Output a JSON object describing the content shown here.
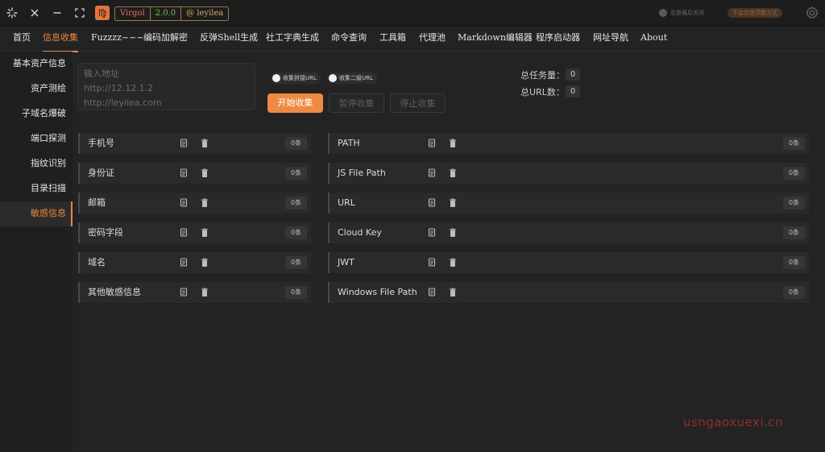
{
  "titlebar": {
    "badges": {
      "name": "Virgol",
      "version": "2.0.0",
      "user": "@ leyilea"
    },
    "toggle_label": "总是最后关闭",
    "pill_label": "不会总是顶置方式"
  },
  "menu": [
    {
      "label": "首页"
    },
    {
      "label": "信息收集"
    },
    {
      "label": "Fuzzzz~~~"
    },
    {
      "label": "编码加解密"
    },
    {
      "label": "反弹Shell生成"
    },
    {
      "label": "社工字典生成"
    },
    {
      "label": "命令查询"
    },
    {
      "label": "工具箱"
    },
    {
      "label": "代理池"
    },
    {
      "label": "Markdown编辑器"
    },
    {
      "label": "程序启动器"
    },
    {
      "label": "网址导航"
    },
    {
      "label": "About"
    }
  ],
  "sidebar": [
    {
      "label": "基本资产信息"
    },
    {
      "label": "资产测绘"
    },
    {
      "label": "子域名爆破"
    },
    {
      "label": "端口探测"
    },
    {
      "label": "指纹识别"
    },
    {
      "label": "目录扫描"
    },
    {
      "label": "敏感信息"
    }
  ],
  "url_input": {
    "placeholder": "输入地址\nhttp://12.12.1.2\nhttp://leyilea.com"
  },
  "options": {
    "collect_url": "收集拼接URL",
    "collect_second": "收集二级URL"
  },
  "buttons": {
    "start": "开始收集",
    "pause": "暂停收集",
    "stop": "停止收集"
  },
  "stats": {
    "total_tasks_label": "总任务量：",
    "total_tasks": "0",
    "total_urls_label": "总URL数：",
    "total_urls": "0"
  },
  "results_left": [
    {
      "label": "手机号",
      "count": "0条"
    },
    {
      "label": "身份证",
      "count": "0条"
    },
    {
      "label": "邮箱",
      "count": "0条"
    },
    {
      "label": "密码字段",
      "count": "0条"
    },
    {
      "label": "域名",
      "count": "0条"
    },
    {
      "label": "其他敏感信息",
      "count": "0条"
    }
  ],
  "results_right": [
    {
      "label": "PATH",
      "count": "0条"
    },
    {
      "label": "JS File Path",
      "count": "0条"
    },
    {
      "label": "URL",
      "count": "0条"
    },
    {
      "label": "Cloud Key",
      "count": "0条"
    },
    {
      "label": "JWT",
      "count": "0条"
    },
    {
      "label": "Windows File Path",
      "count": "0条"
    }
  ],
  "icons": {
    "copy": "copy-icon",
    "delete": "trash-icon"
  },
  "colors": {
    "accent": "#e8873f",
    "background": "#232323"
  },
  "watermark": "usngaoxuexi.cn"
}
